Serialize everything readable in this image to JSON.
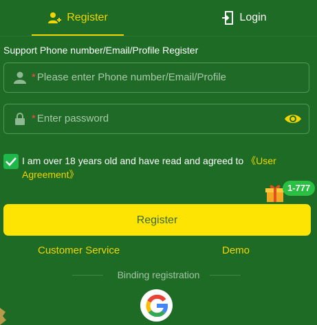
{
  "tabs": {
    "register": "Register",
    "login": "Login"
  },
  "form": {
    "subtitle": "Support Phone number/Email/Profile Register",
    "account_required_mark": "*",
    "account_placeholder": "Please enter Phone number/Email/Profile",
    "password_required_mark": "*",
    "password_placeholder": "Enter password"
  },
  "agreement": {
    "checked": true,
    "text": "I am over 18 years old and have read and agreed to ",
    "link": "《User Agreement》"
  },
  "promo": {
    "badge": "1-777"
  },
  "register_button": "Register",
  "links": {
    "customer_service": "Customer Service",
    "demo": "Demo"
  },
  "binding_label": "Binding registration",
  "colors": {
    "background": "#1d6b25",
    "accent": "#f2d600",
    "button": "#fde403",
    "checkbox": "#1fb64a"
  },
  "icons": [
    "user-add-icon",
    "login-icon",
    "user-icon",
    "lock-icon",
    "eye-icon",
    "check-icon",
    "gift-icon",
    "google-icon"
  ]
}
